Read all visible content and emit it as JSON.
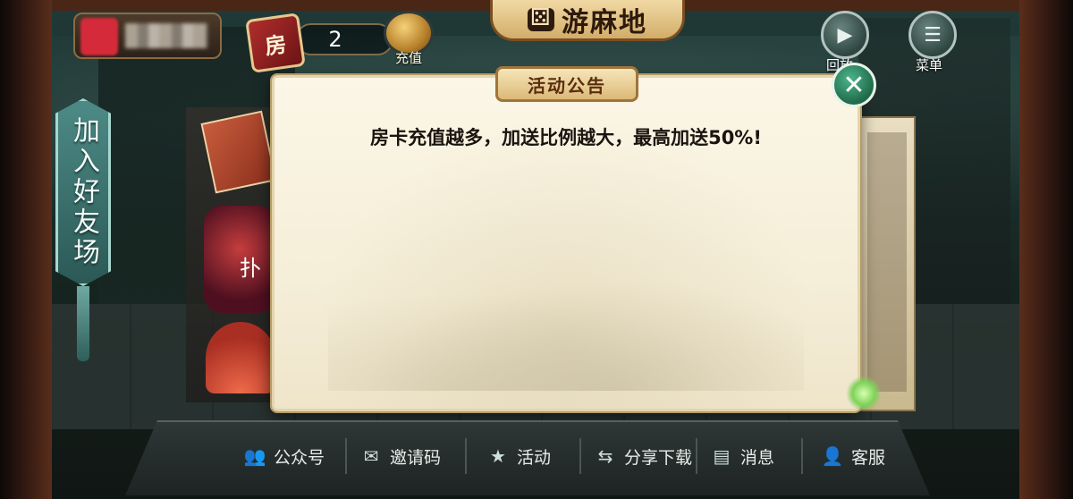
{
  "top_bar": {
    "room_card_label": "房",
    "room_card_count": "2",
    "recharge_label": "充值",
    "logo_text": "游麻地",
    "replay_label": "回放",
    "menu_label": "菜单"
  },
  "left_banner": {
    "join_label": "加入好友场"
  },
  "hall": {
    "partial_label": "扑"
  },
  "notice": {
    "title": "活动公告",
    "message": "房卡充值越多，加送比例越大，最高加送50%!",
    "close_icon": "✕"
  },
  "bottom_nav": {
    "items": [
      {
        "label": "公众号",
        "icon": "people-icon"
      },
      {
        "label": "邀请码",
        "icon": "invite-icon"
      },
      {
        "label": "活动",
        "icon": "star-book-icon"
      },
      {
        "label": "分享下载",
        "icon": "share-icon"
      },
      {
        "label": "消息",
        "icon": "message-icon"
      },
      {
        "label": "客服",
        "icon": "support-icon"
      }
    ]
  },
  "colors": {
    "modal_bg": "#f5eed8",
    "title_gold": "#dcb977",
    "close_green": "#2e8a62",
    "banner_teal": "#3c7672"
  }
}
